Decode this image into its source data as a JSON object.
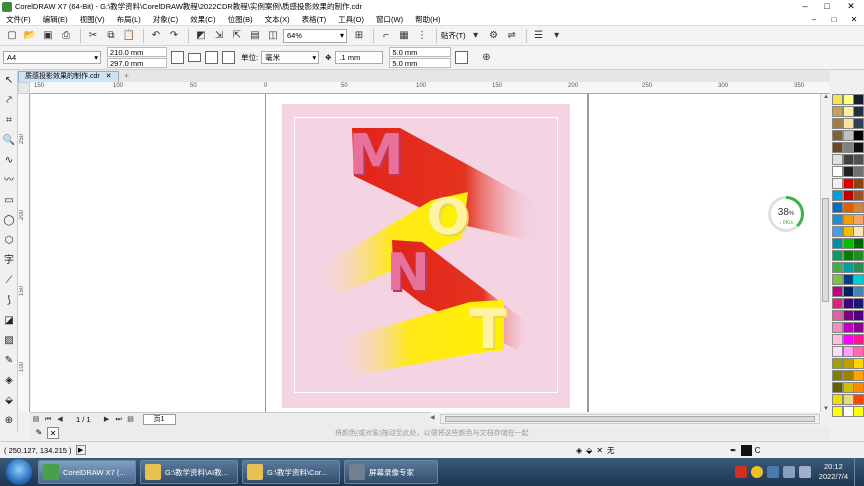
{
  "window": {
    "title": "CorelDRAW X7 (64-Bit) - G:\\教学资料\\CorelDRAW教程\\2022CDR教程\\实例案例\\质感投影效果的制作.cdr",
    "controls": [
      "–",
      "□",
      "✕"
    ]
  },
  "menubar": {
    "items": [
      "文件(F)",
      "编辑(E)",
      "视图(V)",
      "布局(L)",
      "对象(C)",
      "效果(C)",
      "位图(B)",
      "文本(X)",
      "表格(T)",
      "工具(O)",
      "窗口(W)",
      "帮助(H)"
    ],
    "right_controls": [
      "–",
      "□",
      "✕"
    ]
  },
  "toolbar": {
    "zoom": "64%",
    "snap_label": "贴齐(T)"
  },
  "propbar": {
    "page_size": "A4",
    "width": "210.0 mm",
    "height": "297.0 mm",
    "unit_label": "单位:",
    "unit_value": "毫米",
    "nudge": ".1 mm",
    "dup_x": "5.0 mm",
    "dup_y": "5.0 mm"
  },
  "doctab": {
    "name": "质感投影效果的制作.cdr",
    "close": "✕",
    "add": "+"
  },
  "rulers": {
    "top": [
      "150",
      "100",
      "50",
      "0",
      "50",
      "100",
      "150",
      "200",
      "250",
      "300",
      "350"
    ],
    "left": [
      "250",
      "200",
      "150",
      "100"
    ]
  },
  "artwork": {
    "letters": [
      "M",
      "O",
      "N",
      "T"
    ],
    "colors": {
      "background": "#f4d3e3",
      "pink": "#e8719c",
      "red_shadow": "#e2231a",
      "yellow_shadow": "#ffe81a",
      "pale": "#fff3a0"
    }
  },
  "speed_widget": {
    "percent": "38",
    "percent_sign": "%",
    "rate": "↓ 0K/s",
    "progress": 0.38
  },
  "pagenav": {
    "count": "1 / 1",
    "page_tab": "页1"
  },
  "hint": {
    "text": "将颜色(或对象)拖动至此处，以便将这些颜色与文档存储在一起"
  },
  "status": {
    "coords": "( 250.127, 134.215 )",
    "fill_none": "无",
    "outline_c": "C"
  },
  "taskbar": {
    "items": [
      {
        "label": "CorelDRAW X7 (...",
        "active": true
      },
      {
        "label": "G:\\教学资料\\AI教...",
        "active": false
      },
      {
        "label": "G:\\教学资料\\Cor...",
        "active": false
      },
      {
        "label": "屏幕录像专家",
        "active": false
      }
    ],
    "time": "20:12",
    "date": "2022/7/4"
  },
  "palette": {
    "col1": [
      "#f5e15a",
      "#c8a050",
      "#a08040",
      "#806030",
      "#6a4a20",
      "#e0e0e0",
      "#ffffff",
      "#f0f0f0",
      "#00a0e0",
      "#0070c0",
      "#1e90d0",
      "#40a0e0",
      "#0090a0",
      "#00a060",
      "#40b040",
      "#80c040",
      "#c00080",
      "#e0207a",
      "#e060a0",
      "#f090c0",
      "#ffc0e0",
      "#ffe0f0",
      "#a0a000",
      "#808000",
      "#606000",
      "#f0e000",
      "#ffff00"
    ],
    "col2": [
      "#ffff80",
      "#fff0a0",
      "#ffe0a0",
      "#c0c0c0",
      "#808080",
      "#404040",
      "#202020",
      "#e00000",
      "#c00000",
      "#e06000",
      "#f0a000",
      "#f0c000",
      "#00c000",
      "#008000",
      "#00a0a0",
      "#004080",
      "#002060",
      "#400080",
      "#800080",
      "#c000c0",
      "#ff00ff",
      "#ffa0ff",
      "#c0a000",
      "#a08000",
      "#d0c000",
      "#e0e080",
      "#ffffff"
    ],
    "col3": [
      "#102030",
      "#203040",
      "#304050",
      "#000000",
      "#101010",
      "#505050",
      "#707070",
      "#8b4513",
      "#a0522d",
      "#cd853f",
      "#f4a460",
      "#ffe4b5",
      "#006400",
      "#228b22",
      "#2e8b57",
      "#00ced1",
      "#4682b4",
      "#191970",
      "#4b0082",
      "#8b008b",
      "#ff1493",
      "#ff69b4",
      "#ffd700",
      "#ffa500",
      "#ff8c00",
      "#ff4500",
      "#ffff00"
    ]
  }
}
